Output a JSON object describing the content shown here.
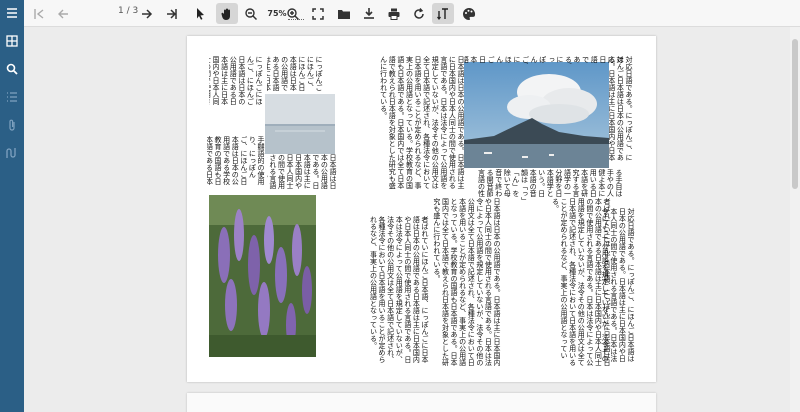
{
  "toolbar": {
    "page_indicator": "1 / 3",
    "zoom_label": "75%",
    "icons": [
      "first-page-icon",
      "prev-page-icon",
      "next-page-icon",
      "last-page-icon",
      "select-tool-icon",
      "pan-tool-icon",
      "zoom-out-icon",
      "zoom-in-icon",
      "fit-page-icon",
      "open-file-icon",
      "download-icon",
      "print-icon",
      "rotate-icon",
      "text-direction-icon",
      "theme-icon"
    ]
  },
  "sidebar": {
    "icons": [
      "menu-icon",
      "thumbnails-icon",
      "search-icon",
      "outline-icon",
      "attachments-icon",
      "signatures-icon"
    ]
  },
  "document": {
    "text_a": "にっぽんごにほんご、にほんご日本語は日本の公用語である日本語は主に日本国内や日本人同士の間で使用される言語である。日本は法令によって公用語を規定していないが、法令その他の公用文は全て日本語で記述され、各種法令において日本語を用いることが定められるなど、事実上の公用語となっている。学校教育の国語も日本語である。",
    "text_b": "日本語は日本の公用語である。日本語は主に日本国内や日本人同士の間で使用される言語である。日本は法令によって公用語を規定していないが、法令その他の公用文は全て日本語で記述され、各種法令において日本語を用いることが定められるなど、事実上の公用語となっている。学校教育の国語も日本語である。日本国内では全て日本語で教えられ日本語を対象とした研究も盛んに行われている。",
    "text_c": "手嬲語的の使用り、にっぽんご、にほんご日本語は日本の公用語である学校教育の国語も日本語である日本国内で使用される言語である",
    "text_d": "る手目は手やの人健よ本に用いる日本語を研究する言語学の一分野を日本語学という。日本語の音韻は「っ」「ん」を除いて母音で終わる開音節言語の性格が強く",
    "text_e": "対応日語である。にっぽんご、にほんご日本語は日本の公用語である。日本語は主に日本国内や日本人同士の間で使用される言語である。日本は法令によって公用語を規定していないが、法令その他の公用文は全て日本語で記述され、各種法令において日本語を用いることが定められるなど、事実上の公用語となっている。学校教育の国語も日本語である。",
    "text_f": "者ばれていにほんご日本語、にっぽんごに日本語は日本の公用語である日本語は主に日本国内や日本人同士の間で使用される言語である。日本は法令によって公用語を規定していないが、法令その他の公用文は全て日本語で記述され、各種法令において日本語を用いることが定められるなど、事実上の公用語となっている。"
  }
}
